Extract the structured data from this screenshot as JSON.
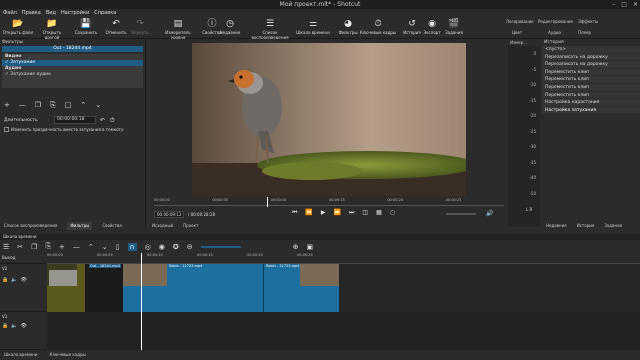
{
  "window": {
    "title": "Мой проект.mlt* - Shotcut"
  },
  "menu": [
    "Файл",
    "Правка",
    "Вид",
    "Настройки",
    "Справка"
  ],
  "toolbar": [
    {
      "label": "Открыть файл",
      "icon": "folder-open-icon"
    },
    {
      "label": "Открыть другой",
      "icon": "folder-icon"
    },
    {
      "label": "Сохранить",
      "icon": "save-icon"
    },
    {
      "label": "Отменить",
      "icon": "undo-icon"
    },
    {
      "label": "Вернуть",
      "icon": "redo-icon"
    },
    {
      "label": "Измеритель уровня",
      "icon": "level-meter-icon"
    },
    {
      "label": "Свойства",
      "icon": "info-icon"
    },
    {
      "label": "Недавние",
      "icon": "clock-icon"
    },
    {
      "label": "Список воспроизведения",
      "icon": "list-icon"
    },
    {
      "label": "Шкала времени",
      "icon": "timeline-icon"
    },
    {
      "label": "Фильтры",
      "icon": "filter-icon"
    },
    {
      "label": "Ключевые кадры",
      "icon": "keyframes-icon"
    },
    {
      "label": "История",
      "icon": "history-icon"
    },
    {
      "label": "Экспорт",
      "icon": "export-icon"
    },
    {
      "label": "Задания",
      "icon": "jobs-icon"
    }
  ],
  "layouts": {
    "row1": [
      "Логирование",
      "Редактирование",
      "Эффекты"
    ],
    "row2": [
      "Цвет",
      "Аудио",
      "Плеер"
    ]
  },
  "filters_panel": {
    "title": "Фильтры",
    "clip_name": "Out - 18244.mp4",
    "video_header": "Видео",
    "video_filter": "Затухание",
    "audio_header": "Аудио",
    "audio_filter": "Затухание аудио",
    "duration_label": "Длительность",
    "duration_value": "00:00:00:18",
    "opacity_checkbox": "Изменить прозрачность вместо затухания в темноту"
  },
  "player": {
    "ruler": [
      "00:00:00",
      "00:00:05",
      "00:00:10",
      "00:00:15",
      "00:00:20",
      "00:00:25"
    ],
    "current_time": "00:00:09:13",
    "total_time": "/ 00:00:28:28",
    "tabs": [
      "Исходный",
      "Проект"
    ]
  },
  "meter": {
    "title": "Измер...",
    "scale": [
      "0",
      "-5",
      "-10",
      "-15",
      "-20",
      "-25",
      "-30",
      "-35",
      "-40",
      "-50"
    ],
    "channels": "L R"
  },
  "history": {
    "title": "История",
    "items": [
      "<пусто>",
      "Перезаписать на дорожку",
      "Перезаписать на дорожку",
      "Переместить клип",
      "Переместить клип",
      "Переместить клип",
      "Переместить клип",
      "Настройка нарастания",
      "Настройка затухания"
    ],
    "selected_index": 8,
    "tabs": [
      "Недавние",
      "История",
      "Задания"
    ]
  },
  "left_tabs": [
    "Список воспроизведения",
    "Фильтры",
    "Свойства"
  ],
  "timeline": {
    "title": "Шкала времени",
    "ruler": [
      "00:00:00",
      "00:00:05",
      "00:00:10",
      "00:00:15",
      "00:00:20",
      "00:00:25"
    ],
    "output_label": "Выход",
    "tracks": [
      {
        "name": "V2",
        "clips": [
          {
            "label": "Out - 18244.mp4"
          },
          {
            "label": "Robin - 21723.mp4"
          },
          {
            "label": "Robin - 21723.mp4"
          }
        ]
      },
      {
        "name": "V1",
        "clips": []
      }
    ]
  },
  "status_tabs": [
    "Шкала времени",
    "Ключевые кадры"
  ],
  "colors": {
    "accent": "#1f5d87",
    "clip": "#1d6fa0"
  }
}
